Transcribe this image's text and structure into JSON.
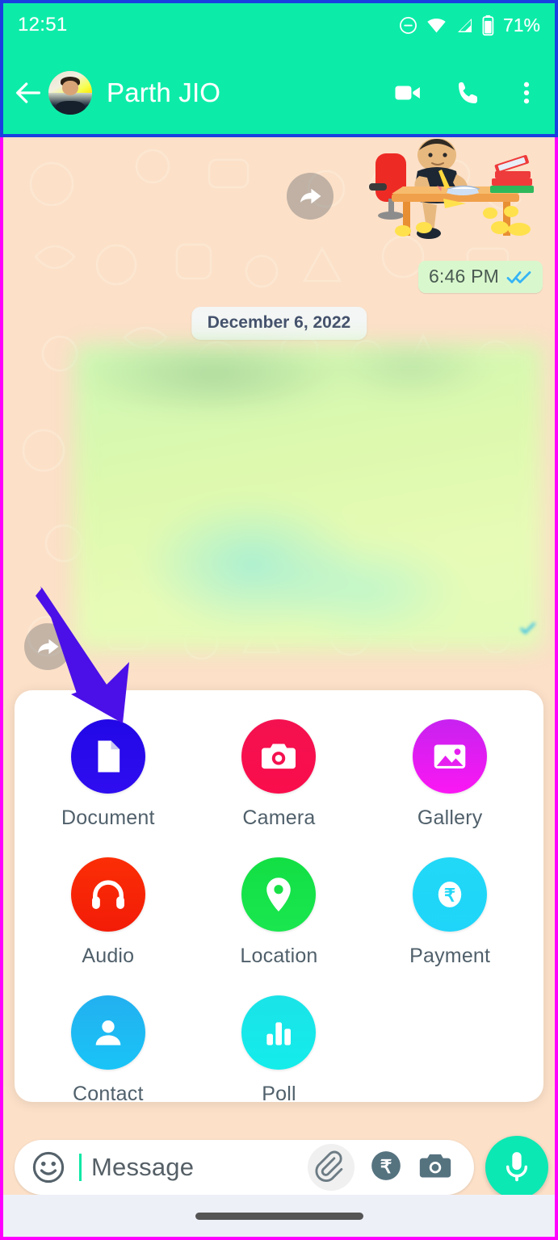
{
  "statusbar": {
    "time": "12:51",
    "battery_percent": "71%",
    "icons": [
      "dnd-icon",
      "wifi-icon",
      "signal-icon",
      "battery-icon"
    ]
  },
  "header": {
    "contact_name": "Parth JIO",
    "back_icon": "back-arrow-icon",
    "avatar_name": "contact-avatar",
    "actions": [
      {
        "name": "video-call-button",
        "icon": "video-camera-icon"
      },
      {
        "name": "voice-call-button",
        "icon": "phone-icon"
      },
      {
        "name": "overflow-menu-button",
        "icon": "more-vertical-icon"
      }
    ],
    "background_color": "#0ceca8"
  },
  "chat": {
    "background_color": "#fce0c8",
    "date_divider": "December 6, 2022",
    "messages": [
      {
        "type": "sticker",
        "name": "sticker-message",
        "description": "person studying at a desk sticker",
        "time": "6:46 PM",
        "status": "read",
        "forward_icon": "forward-arrow-icon"
      },
      {
        "type": "text",
        "name": "blurred-outgoing-message",
        "content": "",
        "redacted": true,
        "forward_icon": "forward-arrow-icon"
      }
    ],
    "annotation": {
      "name": "annotation-arrow",
      "color": "#4b10e8",
      "points_to": "Document"
    }
  },
  "attachment_panel": {
    "name": "attachment-sheet",
    "background_color": "#ffffff",
    "items": [
      {
        "label": "Document",
        "icon": "document-icon",
        "color": "#2208e6"
      },
      {
        "label": "Camera",
        "icon": "camera-icon",
        "color": "#f4114f"
      },
      {
        "label": "Gallery",
        "icon": "image-icon",
        "color": "#e61ef0"
      },
      {
        "label": "Audio",
        "icon": "headphones-icon",
        "color": "#f92607"
      },
      {
        "label": "Location",
        "icon": "map-pin-icon",
        "color": "#17e046"
      },
      {
        "label": "Payment",
        "icon": "rupee-icon",
        "color": "#21d8f7"
      },
      {
        "label": "Contact",
        "icon": "person-icon",
        "color": "#1fb9f2"
      },
      {
        "label": "Poll",
        "icon": "bar-chart-icon",
        "color": "#19e6e6"
      }
    ]
  },
  "input_bar": {
    "placeholder": "Message",
    "value": "",
    "emoji_icon": "emoji-smiley-icon",
    "attach_icon": "paperclip-icon",
    "payment_icon": "rupee-circle-icon",
    "camera_icon": "camera-icon",
    "mic_icon": "microphone-icon",
    "mic_color": "#0ce8b4"
  },
  "navbar": {
    "name": "android-gesture-bar"
  }
}
